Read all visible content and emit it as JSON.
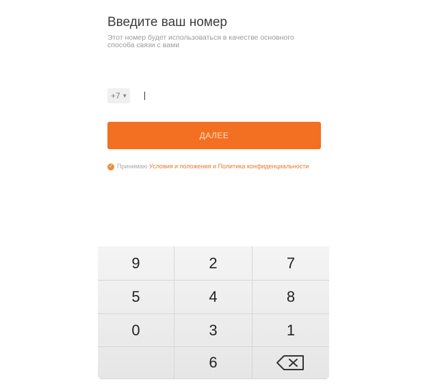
{
  "screen": {
    "title": "Введите ваш номер",
    "subtitle": "Этот номер будет использоваться в качестве основного способа связи с вами"
  },
  "phone_input": {
    "country_code": "+7",
    "dropdown_glyph": "▾",
    "value": ""
  },
  "next_button": {
    "label": "ДАЛЕЕ"
  },
  "terms": {
    "prefix": "Принимаю",
    "link_text": "Условия и положения и Политика конфиденциальности",
    "checked": true
  },
  "keypad": {
    "keys": [
      "9",
      "2",
      "7",
      "5",
      "4",
      "8",
      "0",
      "3",
      "1",
      "",
      "6",
      "backspace"
    ]
  },
  "colors": {
    "accent": "#f36f21",
    "link": "#e8782e"
  }
}
